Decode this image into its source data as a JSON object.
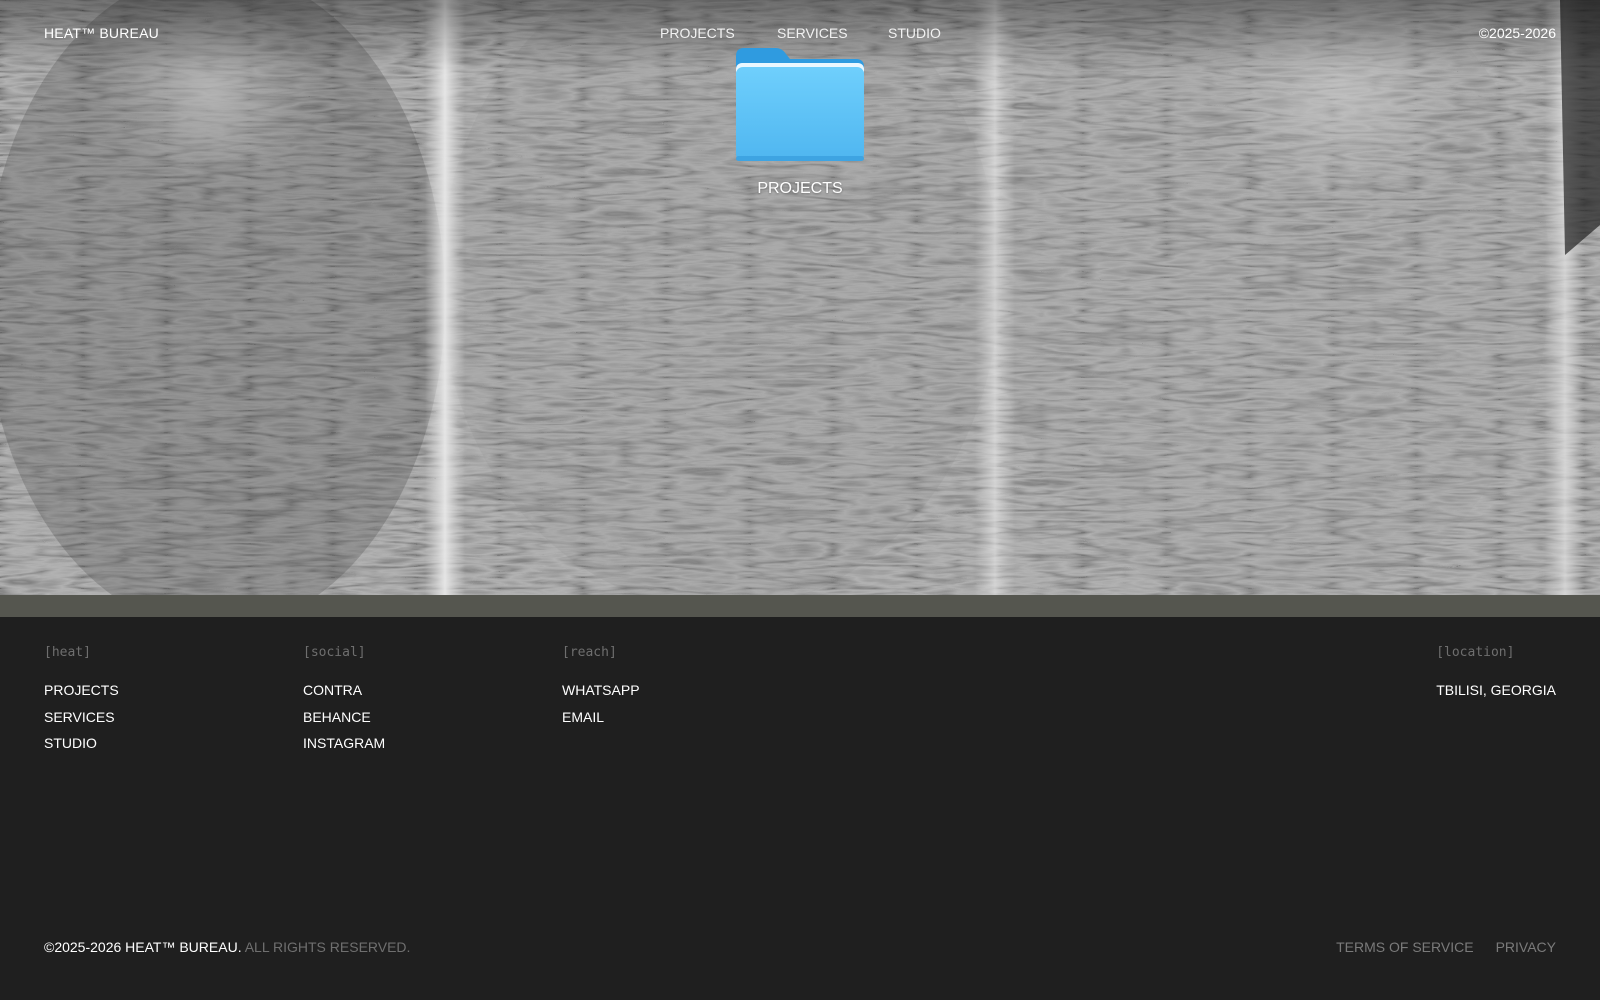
{
  "header": {
    "brand": "HEAT™ BUREAU",
    "nav": [
      "PROJECTS",
      "SERVICES",
      "STUDIO"
    ],
    "copyright": "©2025-2026"
  },
  "hero": {
    "folder_icon": "folder-icon",
    "folder_label": "PROJECTS"
  },
  "footer": {
    "columns": [
      {
        "heading": "[heat]",
        "links": [
          "PROJECTS",
          "SERVICES",
          "STUDIO"
        ]
      },
      {
        "heading": "[social]",
        "links": [
          "CONTRA",
          "BEHANCE",
          "INSTAGRAM"
        ]
      },
      {
        "heading": "[reach]",
        "links": [
          "WHATSAPP",
          "EMAIL"
        ]
      },
      {
        "heading": "[location]",
        "links": [
          "TBILISI, GEORGIA"
        ]
      }
    ],
    "copyright_main": "©2025-2026 HEAT™ BUREAU.",
    "copyright_rights": "ALL RIGHTS RESERVED.",
    "legal": [
      "TERMS OF SERVICE",
      "PRIVACY"
    ]
  },
  "colors": {
    "footer_bg": "#1f1f1f",
    "strip": "#55564f",
    "folder_blue": "#5ec2f8",
    "muted_text": "#6e6e6e"
  }
}
